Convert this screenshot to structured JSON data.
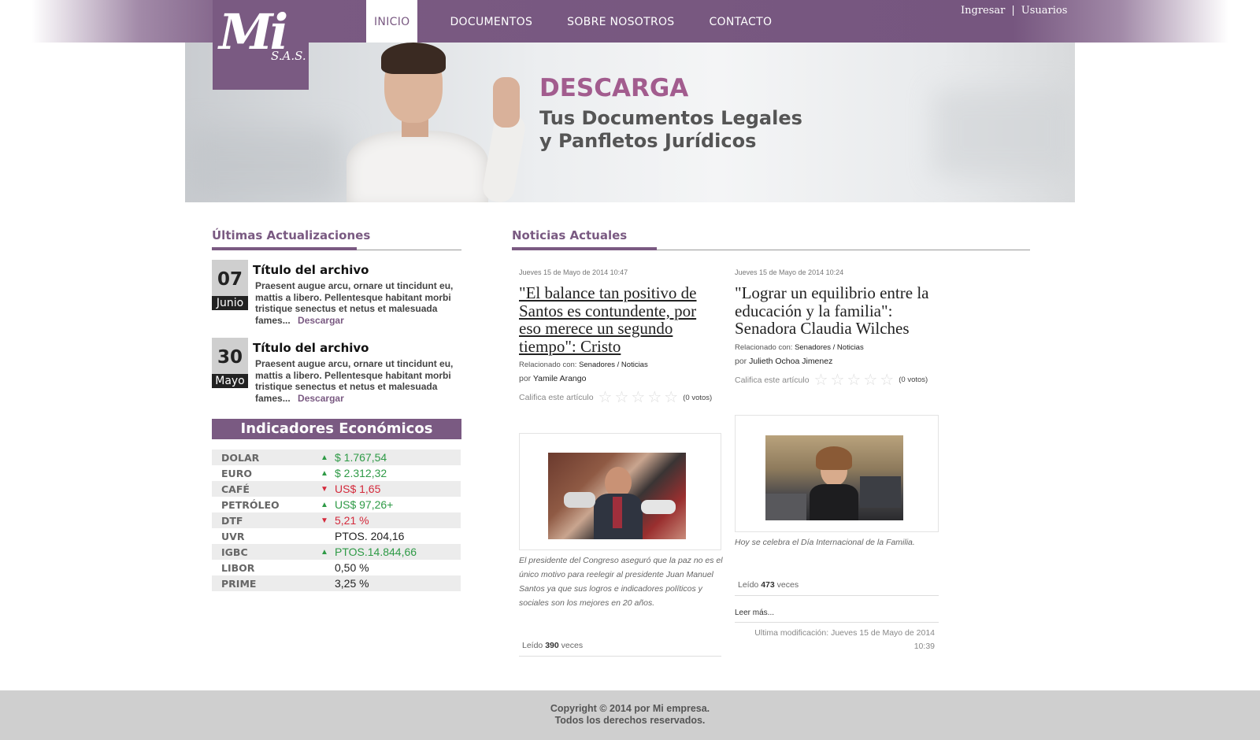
{
  "brand": {
    "logo_main": "Mi",
    "logo_suffix": "S.A.S."
  },
  "nav": {
    "items": [
      {
        "label": "INICIO",
        "active": true
      },
      {
        "label": "DOCUMENTOS"
      },
      {
        "label": "SOBRE NOSOTROS"
      },
      {
        "label": "CONTACTO"
      }
    ],
    "user_links": {
      "login": "Ingresar",
      "users": "Usuarios"
    }
  },
  "banner": {
    "title": "DESCARGA",
    "subtitle_line1": "Tus Documentos Legales",
    "subtitle_line2": "y Panfletos Jurídicos"
  },
  "updates": {
    "title": "Últimas Actualizaciones",
    "items": [
      {
        "day": "07",
        "month": "Junio",
        "title": "Título del archivo",
        "text": "Praesent augue arcu, ornare ut tincidunt eu, mattis a libero. Pellentesque habitant morbi tristique senectus et netus et malesuada fames...",
        "link": "Descargar"
      },
      {
        "day": "30",
        "month": "Mayo",
        "title": "Título del archivo",
        "text": "Praesent augue arcu, ornare ut tincidunt eu, mattis a libero. Pellentesque habitant morbi tristique senectus et netus et malesuada fames...",
        "link": "Descargar"
      }
    ]
  },
  "indicators": {
    "title": "Indicadores Económicos",
    "colors": {
      "up": "#2e9a46",
      "down": "#d4293b",
      "flat": "#222222"
    },
    "rows": [
      {
        "name": "DOLAR",
        "trend": "up",
        "value": "$ 1.767,54"
      },
      {
        "name": "EURO",
        "trend": "up",
        "value": "$ 2.312,32"
      },
      {
        "name": "CAFÉ",
        "trend": "down",
        "value": "US$ 1,65"
      },
      {
        "name": "PETRÓLEO",
        "trend": "up",
        "value": "US$ 97,26+"
      },
      {
        "name": "DTF",
        "trend": "down",
        "value": "5,21 %"
      },
      {
        "name": "UVR",
        "trend": "flat",
        "value": "PTOS. 204,16"
      },
      {
        "name": "IGBC",
        "trend": "up",
        "value": "PTOS.14.844,66"
      },
      {
        "name": "LIBOR",
        "trend": "flat",
        "value": "0,50 %"
      },
      {
        "name": "PRIME",
        "trend": "flat",
        "value": "3,25 %"
      }
    ]
  },
  "news": {
    "title": "Noticias Actuales",
    "items": [
      {
        "date": "Jueves 15 de Mayo de 2014 10:47",
        "headline": "\"El balance tan positivo de Santos es contundente, por eso merece un segundo tiempo\": Cristo",
        "related_label": "Relacionado con:",
        "related_value": "Senadores / Noticias",
        "by_label": "por",
        "author": "Yamile Arango",
        "rate_label": "Califica este artículo",
        "votes": "(0 votos)",
        "caption": "El presidente del Congreso aseguró que la paz no es el único motivo para reelegir al presidente Juan Manuel Santos ya que sus logros e indicadores políticos y sociales son los mejores en 20 años.",
        "read_label": "Leído",
        "read_count": "390",
        "read_suffix": "veces"
      },
      {
        "date": "Jueves 15 de Mayo de 2014 10:24",
        "headline": "\"Lograr un equilibrio entre la educación y la familia\": Senadora Claudia Wilches",
        "related_label": "Relacionado con:",
        "related_value": "Senadores / Noticias",
        "by_label": "por",
        "author": "Julieth Ochoa Jimenez",
        "rate_label": "Califica este artículo",
        "votes": "(0 votos)",
        "caption": "Hoy se celebra el Día Internacional de la Familia.",
        "read_label": "Leído",
        "read_count": "473",
        "read_suffix": "veces",
        "more": "Leer más...",
        "modified": "Ultima modificación: Jueves 15 de Mayo de 2014",
        "modified_time": "10:39"
      }
    ]
  },
  "footer": {
    "line1": "Copyright © 2014 por Mi empresa.",
    "line2": "Todos los derechos reservados."
  }
}
